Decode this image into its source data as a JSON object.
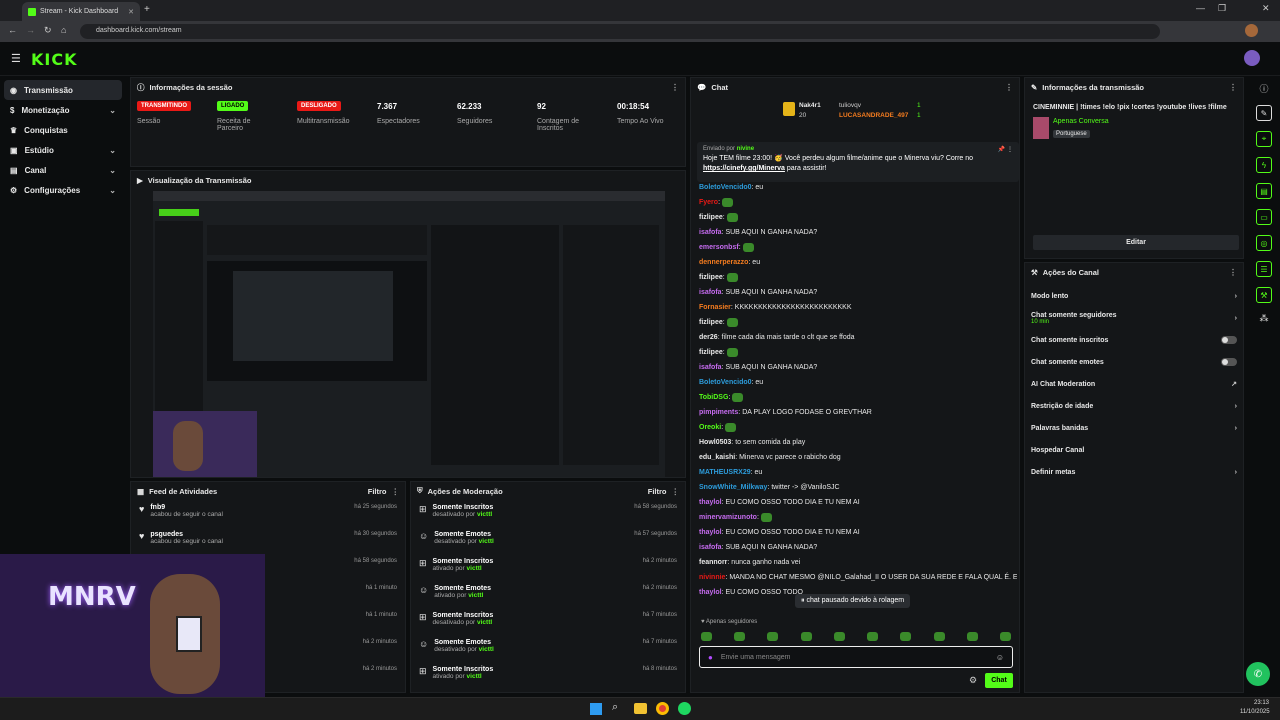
{
  "browser": {
    "tab_title": "Stream - Kick Dashboard",
    "url": "dashboard.kick.com/stream"
  },
  "header": {
    "logo": "KICK"
  },
  "sidebar": {
    "items": [
      {
        "label": "Transmissão"
      },
      {
        "label": "Monetização"
      },
      {
        "label": "Conquistas"
      },
      {
        "label": "Estúdio"
      },
      {
        "label": "Canal"
      },
      {
        "label": "Configurações"
      }
    ]
  },
  "session": {
    "title": "Informações da sessão",
    "stats": [
      {
        "value": "TRANSMITINDO",
        "label": "Sessão",
        "badge_color": "#e91916"
      },
      {
        "value": "LIGADO",
        "label": "Receita de Parceiro",
        "badge_color": "#53fc18"
      },
      {
        "value": "DESLIGADO",
        "label": "Multitransmissão",
        "badge_color": "#e91916"
      },
      {
        "value": "7.367",
        "label": "Espectadores"
      },
      {
        "value": "62.233",
        "label": "Seguidores"
      },
      {
        "value": "92",
        "label": "Contagem de Inscritos"
      },
      {
        "value": "00:18:54",
        "label": "Tempo Ao Vivo"
      }
    ]
  },
  "preview": {
    "title": "Visualização da Transmissão"
  },
  "feed": {
    "title": "Feed de Atividades",
    "filter": "Filtro",
    "items": [
      {
        "name": "fnb9",
        "sub": "acabou de seguir o canal",
        "time": "há 25 segundos"
      },
      {
        "name": "psguedes",
        "sub": "acabou de seguir o canal",
        "time": "há 30 segundos"
      },
      {
        "name": "",
        "sub": "",
        "time": "há 58 segundos"
      },
      {
        "name": "",
        "sub": "",
        "time": "há 1 minuto"
      },
      {
        "name": "",
        "sub": "",
        "time": "há 1 minuto"
      },
      {
        "name": "",
        "sub": "",
        "time": "há 2 minutos"
      },
      {
        "name": "",
        "sub": "",
        "time": "há 2 minutos"
      }
    ]
  },
  "moderation": {
    "title": "Ações de Moderação",
    "filter": "Filtro",
    "items": [
      {
        "name": "Somente Inscritos",
        "sub": "desativado por",
        "by": "victtl",
        "time": "há 58 segundos"
      },
      {
        "name": "Somente Emotes",
        "sub": "desativado por",
        "by": "victtl",
        "time": "há 57 segundos"
      },
      {
        "name": "Somente Inscritos",
        "sub": "ativado por",
        "by": "victtl",
        "time": "há 2 minutos"
      },
      {
        "name": "Somente Emotes",
        "sub": "ativado por",
        "by": "victtl",
        "time": "há 2 minutos"
      },
      {
        "name": "Somente Inscritos",
        "sub": "desativado por",
        "by": "victtl",
        "time": "há 7 minutos"
      },
      {
        "name": "Somente Emotes",
        "sub": "desativado por",
        "by": "victtl",
        "time": "há 7 minutos"
      },
      {
        "name": "Somente Inscritos",
        "sub": "ativado por",
        "by": "victtl",
        "time": "há 8 minutos"
      }
    ]
  },
  "chat": {
    "title": "Chat",
    "leaderboard": [
      {
        "name": "Nak4r1",
        "count": "20",
        "name2": "tuliovqv",
        "count2": "1"
      },
      {
        "name": "",
        "count": "",
        "name2": "LUCASANDRADE_497",
        "count2": "1"
      }
    ],
    "pinned": {
      "by_label": "Enviado por",
      "by_user": "nivine",
      "text": "Hoje TEM filme 23:00! 🥳 Você perdeu algum filme/anime que o Minerva viu? Corre no",
      "link": "https://cinefy.gg/Minerva",
      "after": "para assistir!"
    },
    "messages": [
      {
        "user": "BoletoVencido0",
        "color": "#2d9cdb",
        "text": "eu"
      },
      {
        "user": "Fyero",
        "color": "#e91916",
        "text": ""
      },
      {
        "user": "fizlipee",
        "color": "#e8e8e8",
        "text": ""
      },
      {
        "user": "isafofa",
        "color": "#c66cf0",
        "text": "SUB AQUI N GANHA NADA?"
      },
      {
        "user": "emersonbsf",
        "color": "#c66cf0",
        "text": ""
      },
      {
        "user": "dennerperazzo",
        "color": "#f57c1f",
        "text": "eu"
      },
      {
        "user": "fizlipee",
        "color": "#e8e8e8",
        "text": ""
      },
      {
        "user": "isafofa",
        "color": "#c66cf0",
        "text": "SUB AQUI N GANHA NADA?"
      },
      {
        "user": "Fornasier",
        "color": "#f57c1f",
        "text": "KKKKKKKKKKKKKKKKKKKKKKKKK"
      },
      {
        "user": "fizlipee",
        "color": "#e8e8e8",
        "text": ""
      },
      {
        "user": "der26",
        "color": "#e8e8e8",
        "text": "filme cada dia mais tarde o clt que se ffoda"
      },
      {
        "user": "fizlipee",
        "color": "#e8e8e8",
        "text": ""
      },
      {
        "user": "isafofa",
        "color": "#c66cf0",
        "text": "SUB AQUI N GANHA NADA?"
      },
      {
        "user": "BoletoVencido0",
        "color": "#2d9cdb",
        "text": "eu"
      },
      {
        "user": "TobiDSG",
        "color": "#53fc18",
        "text": ""
      },
      {
        "user": "pimpiments",
        "color": "#c66cf0",
        "text": "DA PLAY LOGO FODASE O GREVTHAR"
      },
      {
        "user": "Oreoki",
        "color": "#53fc18",
        "text": ""
      },
      {
        "user": "Howl0503",
        "color": "#e8e8e8",
        "text": "to sem comida da play"
      },
      {
        "user": "edu_kaishi",
        "color": "#e8e8e8",
        "text": "Minerva vc parece o rabicho dog"
      },
      {
        "user": "MATHEUSRX29",
        "color": "#2d9cdb",
        "text": "eu"
      },
      {
        "user": "SnowWhite_Milkway",
        "color": "#2d9cdb",
        "text": "twitter -> @VaniloSJC"
      },
      {
        "user": "thaylol",
        "color": "#c66cf0",
        "text": "EU COMO OSSO TODO DIA E TU NEM AI"
      },
      {
        "user": "minervamizunoto",
        "color": "#c66cf0",
        "text": ""
      },
      {
        "user": "thaylol",
        "color": "#c66cf0",
        "text": "EU COMO OSSO TODO DIA E TU NEM AI"
      },
      {
        "user": "isafofa",
        "color": "#c66cf0",
        "text": "SUB AQUI N GANHA NADA?"
      },
      {
        "user": "feannorr",
        "color": "#e8e8e8",
        "text": "nunca ganho nada vei"
      },
      {
        "user": "nivinnie",
        "color": "#e91916",
        "text": "MANDA NO CHAT MESMO @NILO_Galahad_II O USER DA SUA REDE E FALA QUAL É. EXEMPLO: RATOTOLOL - TWITTER"
      },
      {
        "user": "thaylol",
        "color": "#c66cf0",
        "text": "EU COMO OSSO TODO"
      }
    ],
    "paused": "chat pausado devido à rolagem",
    "followers_only": "Apenas seguidores",
    "placeholder": "Envie uma mensagem",
    "send": "Chat"
  },
  "stream_info": {
    "title": "Informações da transmissão",
    "stream_title": "CINEMINNIE | !times !elo !pix !cortes !youtube !lives !filme",
    "category": "Apenas Conversa",
    "language": "Portuguese",
    "edit": "Editar"
  },
  "channel_actions": {
    "title": "Ações do Canal",
    "items": [
      {
        "label": "Modo lento",
        "sub": "",
        "control": "chevron"
      },
      {
        "label": "Chat somente seguidores",
        "sub": "10 min",
        "control": "chevron"
      },
      {
        "label": "Chat somente inscritos",
        "sub": "",
        "control": "toggle"
      },
      {
        "label": "Chat somente emotes",
        "sub": "",
        "control": "toggle"
      },
      {
        "label": "AI Chat Moderation",
        "sub": "",
        "control": "external"
      },
      {
        "label": "Restrição de idade",
        "sub": "",
        "control": "chevron"
      },
      {
        "label": "Palavras banidas",
        "sub": "",
        "control": "chevron"
      },
      {
        "label": "Hospedar Canal",
        "sub": "",
        "control": "none"
      },
      {
        "label": "Definir metas",
        "sub": "",
        "control": "chevron"
      }
    ]
  },
  "taskbar": {
    "time": "23:13",
    "date": "11/10/2025"
  },
  "colors": {
    "accent": "#53fc18",
    "live": "#e91916",
    "panel": "#141618"
  }
}
